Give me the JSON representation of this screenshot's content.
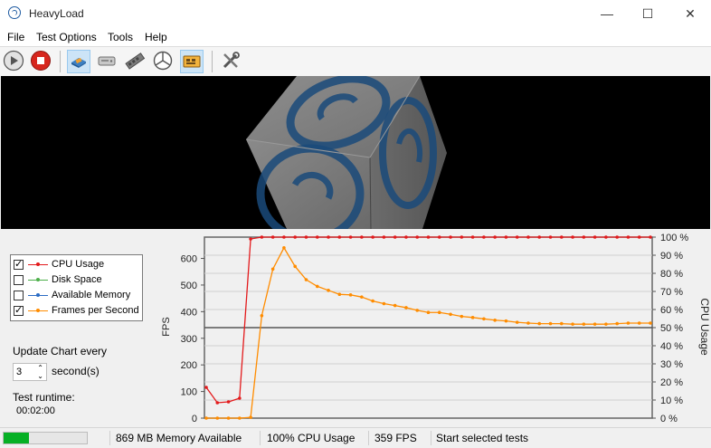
{
  "window": {
    "title": "HeavyLoad",
    "minimize": "—",
    "maximize": "☐",
    "close": "✕"
  },
  "menu": [
    "File",
    "Test Options",
    "Tools",
    "Help"
  ],
  "toolbar": {
    "items": [
      {
        "icon": "play-icon",
        "active": false
      },
      {
        "icon": "stop-icon",
        "active": false
      },
      {
        "icon": "cpu-icon",
        "active": true
      },
      {
        "icon": "disk-icon",
        "active": false
      },
      {
        "icon": "memory-icon",
        "active": false
      },
      {
        "icon": "gpu-icon",
        "active": false
      },
      {
        "icon": "threads-icon",
        "active": true
      },
      {
        "icon": "tools-icon",
        "active": false
      }
    ]
  },
  "legend": [
    {
      "label": "CPU Usage",
      "checked": true,
      "color": "#e31a1c"
    },
    {
      "label": "Disk Space",
      "checked": false,
      "color": "#4daf4a"
    },
    {
      "label": "Available Memory",
      "checked": false,
      "color": "#2b6cc4"
    },
    {
      "label": "Frames per Second",
      "checked": true,
      "color": "#ff8c00"
    }
  ],
  "settings": {
    "update_label": "Update Chart every",
    "update_value": "3",
    "update_unit": "second(s)",
    "runtime_label": "Test runtime:",
    "runtime_value": "00:02:00"
  },
  "chart_data": {
    "type": "line",
    "left_axis": {
      "label": "FPS",
      "ticks": [
        "0",
        "100",
        "200",
        "300",
        "400",
        "500",
        "600"
      ],
      "range": [
        0,
        680
      ]
    },
    "right_axis": {
      "label": "CPU Usage",
      "ticks": [
        "0 %",
        "10 %",
        "20 %",
        "30 %",
        "40 %",
        "50 %",
        "60 %",
        "70 %",
        "80 %",
        "90 %",
        "100 %"
      ],
      "range": [
        0,
        100
      ]
    },
    "reference_line_fps": 340,
    "series": [
      {
        "name": "CPU Usage",
        "axis": "right",
        "color": "#e31a1c",
        "values": [
          17,
          8.5,
          9,
          11,
          99,
          100,
          100,
          100,
          100,
          100,
          100,
          100,
          100,
          100,
          100,
          100,
          100,
          100,
          100,
          100,
          100,
          100,
          100,
          100,
          100,
          100,
          100,
          100,
          100,
          100,
          100,
          100,
          100,
          100,
          100,
          100,
          100,
          100,
          100,
          100,
          100
        ]
      },
      {
        "name": "Frames per Second",
        "axis": "left",
        "color": "#ff8c00",
        "values": [
          0,
          0,
          0,
          0,
          3,
          385,
          560,
          640,
          570,
          520,
          495,
          480,
          465,
          463,
          455,
          440,
          430,
          423,
          415,
          405,
          397,
          397,
          390,
          382,
          378,
          373,
          368,
          365,
          360,
          357,
          355,
          355,
          355,
          353,
          353,
          353,
          353,
          355,
          357,
          357,
          357
        ]
      }
    ]
  },
  "status": {
    "progress": 0.3,
    "memory": "869 MB Memory Available",
    "cpu": "100% CPU Usage",
    "fps": "359 FPS",
    "message": "Start selected tests"
  }
}
